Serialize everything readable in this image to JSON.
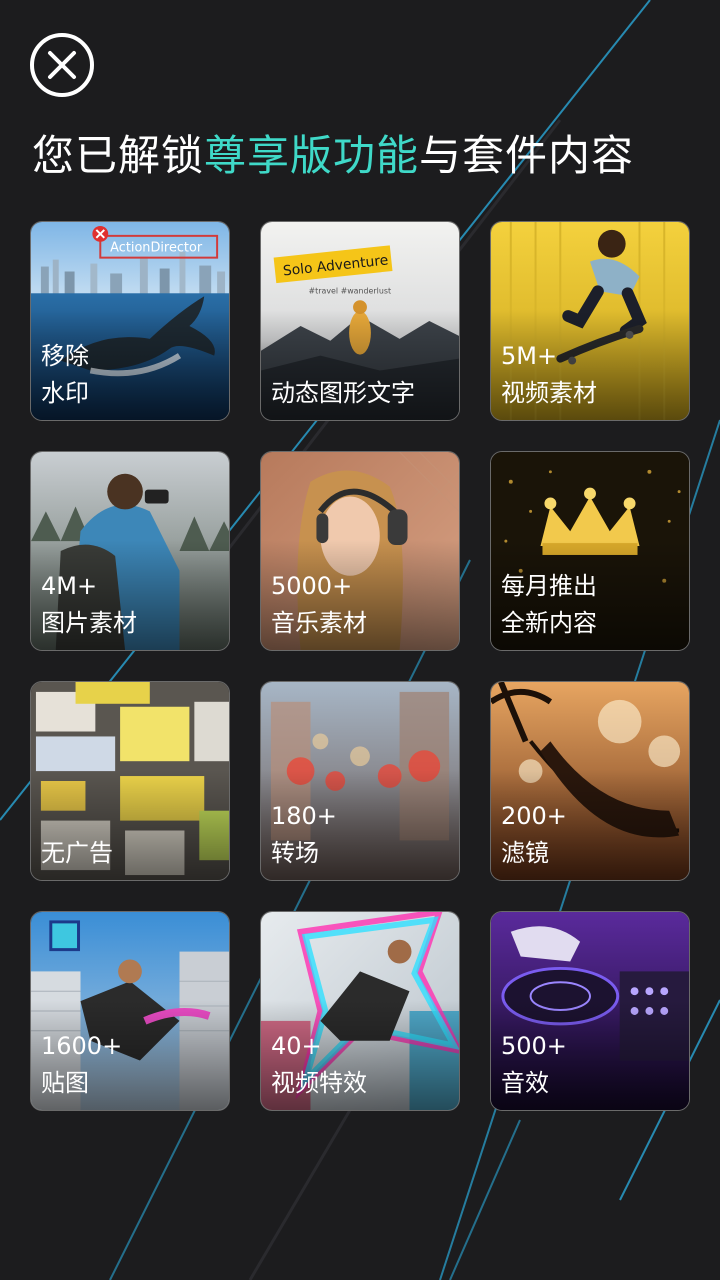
{
  "header": {
    "close_icon": "close-icon",
    "title_prefix": "您已解锁",
    "title_accent": "尊享版功能",
    "title_suffix": "与套件内容"
  },
  "colors": {
    "background": "#1c1c1e",
    "accent": "#3fd9c8",
    "line": "#2aa6d6"
  },
  "features": [
    {
      "line1": "移除",
      "line2": "水印",
      "badge_text": "ActionDirector"
    },
    {
      "line1": "",
      "line2": "动态图形文字",
      "art_title": "Solo Adventure",
      "art_tags": "#travel #wanderlust"
    },
    {
      "line1": "5M+",
      "line2": "视频素材"
    },
    {
      "line1": "4M+",
      "line2": "图片素材"
    },
    {
      "line1": "5000+",
      "line2": "音乐素材"
    },
    {
      "line1": "每月推出",
      "line2": "全新内容"
    },
    {
      "line1": "",
      "line2": "无广告"
    },
    {
      "line1": "180+",
      "line2": "转场"
    },
    {
      "line1": "200+",
      "line2": "滤镜"
    },
    {
      "line1": "1600+",
      "line2": "贴图"
    },
    {
      "line1": "40+",
      "line2": "视频特效"
    },
    {
      "line1": "500+",
      "line2": "音效"
    }
  ]
}
